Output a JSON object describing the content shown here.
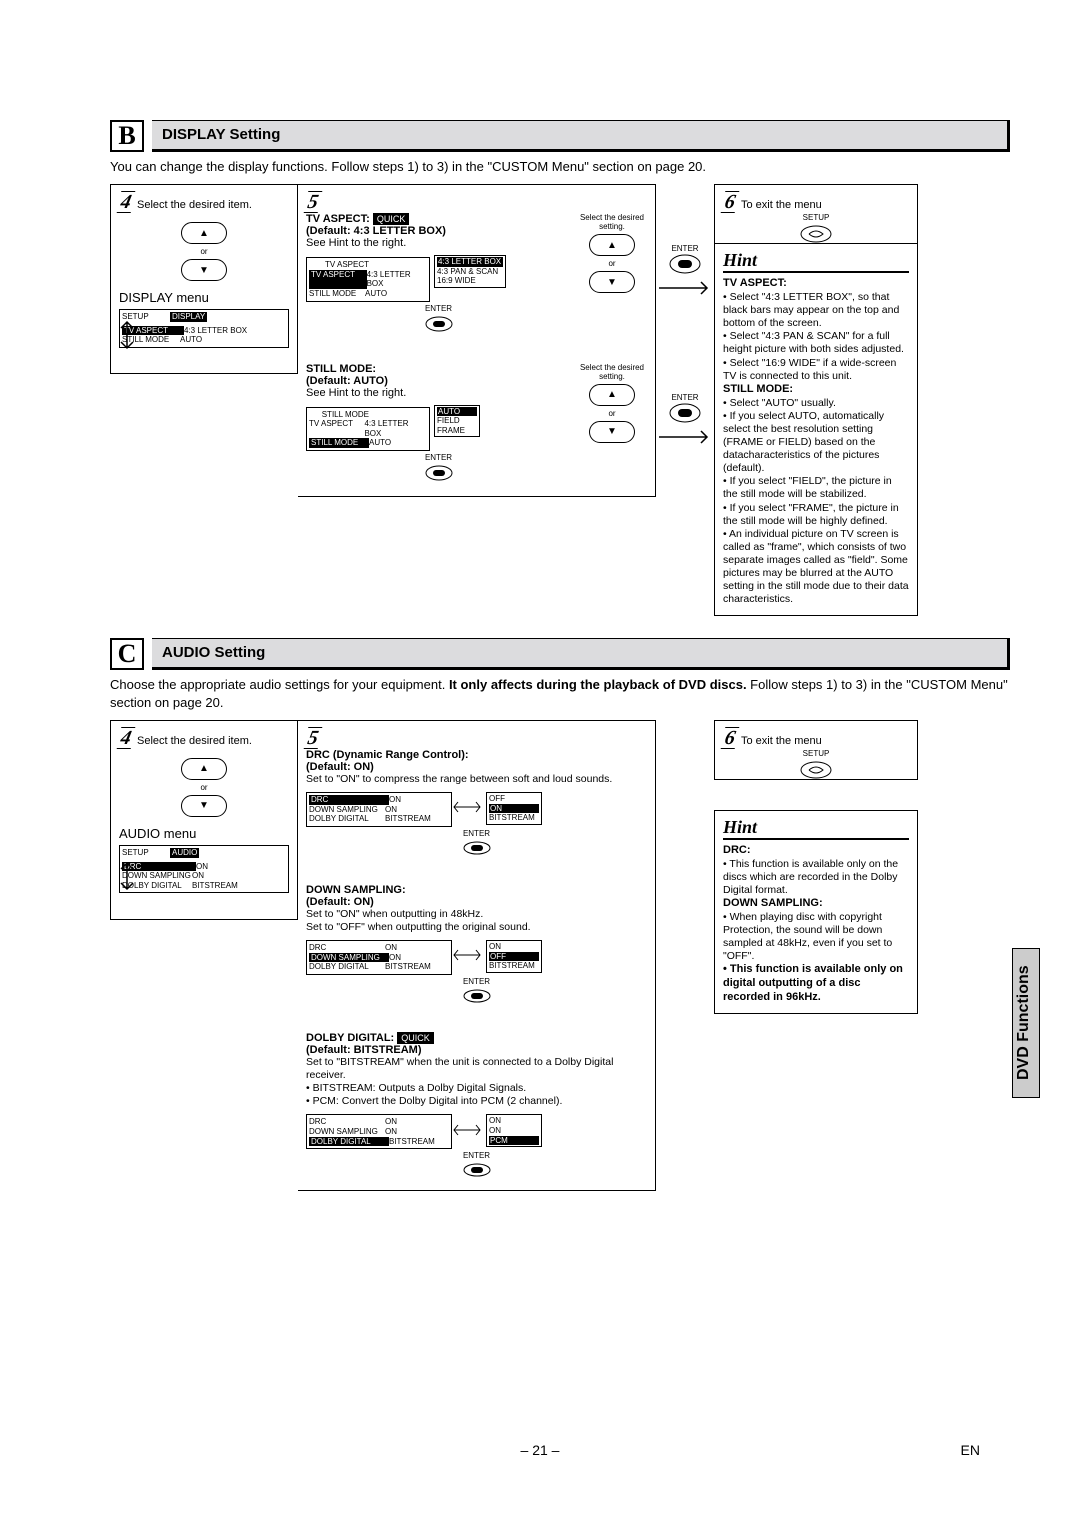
{
  "page_number": "– 21 –",
  "lang_badge": "EN",
  "side_tab": "DVD Functions",
  "quick_label": "QUICK",
  "enter_label": "ENTER",
  "setup_label": "SETUP",
  "or_label": "or",
  "select_setting_text": "Select the desired setting.",
  "step4_caption": "Select the desired item.",
  "step6_caption": "To exit the menu",
  "sectionB": {
    "letter": "B",
    "title": "DISPLAY Setting",
    "intro": "You can change the display functions. Follow steps 1) to 3) in the \"CUSTOM Menu\" section on page 20.",
    "menu_title": "DISPLAY menu",
    "menu_header_left": "SETUP",
    "menu_header_right": "DISPLAY",
    "menu_rows": [
      {
        "left": "TV ASPECT",
        "right": "4:3 LETTER BOX"
      },
      {
        "left": "STILL MODE",
        "right": "AUTO"
      }
    ],
    "tv_aspect": {
      "label": "TV ASPECT:",
      "default": "(Default: 4:3 LETTER BOX)",
      "hint_ref": "See Hint to the right.",
      "options": [
        "4:3 LETTER BOX",
        "4:3 PAN & SCAN",
        "16:9 WIDE"
      ]
    },
    "still_mode": {
      "label": "STILL MODE:",
      "default": "(Default: AUTO)",
      "hint_ref": "See Hint to the right.",
      "options": [
        "AUTO",
        "FIELD",
        "FRAME"
      ]
    },
    "hint": {
      "title": "Hint",
      "tv_aspect_head": "TV ASPECT:",
      "tv_aspect_items": [
        "Select \"4:3 LETTER BOX\", so that black bars may appear on the top and bottom of the screen.",
        "Select \"4:3 PAN & SCAN\" for a full height picture with both sides adjusted.",
        "Select \"16:9 WIDE\" if a wide-screen TV is connected to this unit."
      ],
      "still_head": "STILL MODE:",
      "still_items": [
        "Select \"AUTO\" usually.",
        "If you select AUTO, automatically select the best resolution setting (FRAME or FIELD) based on the datacharacteristics of the pictures (default).",
        "If you select \"FIELD\", the picture in the still mode will be stabilized.",
        "If you select \"FRAME\", the picture in the still mode will be highly defined.",
        "An individual picture on TV screen is called as \"frame\", which consists of two separate images called as \"field\". Some pictures may be blurred at the AUTO setting in the still mode due to their data characteristics."
      ]
    }
  },
  "sectionC": {
    "letter": "C",
    "title": "AUDIO Setting",
    "intro_a": "Choose the appropriate audio settings for your equipment. ",
    "intro_bold": "It only affects during the playback of DVD discs.",
    "intro_b": " Follow steps 1) to 3) in the \"CUSTOM Menu\" section on page 20.",
    "menu_title": "AUDIO menu",
    "menu_header_left": "SETUP",
    "menu_header_right": "AUDIO",
    "menu_rows": [
      {
        "left": "DRC",
        "right": "ON"
      },
      {
        "left": "DOWN SAMPLING",
        "right": "ON"
      },
      {
        "left": "DOLBY DIGITAL",
        "right": "BITSTREAM"
      }
    ],
    "drc": {
      "label": "DRC (Dynamic Range Control):",
      "default": "(Default: ON)",
      "desc": "Set to \"ON\" to compress the range between soft and loud sounds.",
      "opts_left": [
        "DRC  ON",
        "DOWN SAMPLING  ON",
        "DOLBY DIGITAL  BITSTREAM"
      ],
      "opts_right": [
        "OFF",
        "ON",
        "BITSTREAM"
      ]
    },
    "down": {
      "label": "DOWN SAMPLING:",
      "default": "(Default: ON)",
      "desc1": "Set to \"ON\" when outputting in 48kHz.",
      "desc2": "Set to \"OFF\" when outputting the original sound.",
      "opts_right": [
        "ON",
        "OFF",
        "BITSTREAM"
      ]
    },
    "dolby": {
      "label": "DOLBY DIGITAL:",
      "default": "(Default: BITSTREAM)",
      "desc": "Set to \"BITSTREAM\" when the unit is connected to a Dolby Digital receiver.",
      "b1": "BITSTREAM: Outputs a Dolby Digital Signals.",
      "b2": "PCM: Convert the Dolby Digital into PCM (2 channel).",
      "opts_right": [
        "ON",
        "ON",
        "PCM"
      ]
    },
    "hint": {
      "title": "Hint",
      "drc_head": "DRC:",
      "drc_item": "This function is available only on the discs which are recorded in the Dolby Digital format.",
      "down_head": "DOWN SAMPLING:",
      "down_item": "When playing disc with copyright Protection, the sound will be down sampled at 48kHz, even if you set to \"OFF\".",
      "bold_item": "This function is available only on digital outputting of a disc recorded in 96kHz."
    }
  }
}
